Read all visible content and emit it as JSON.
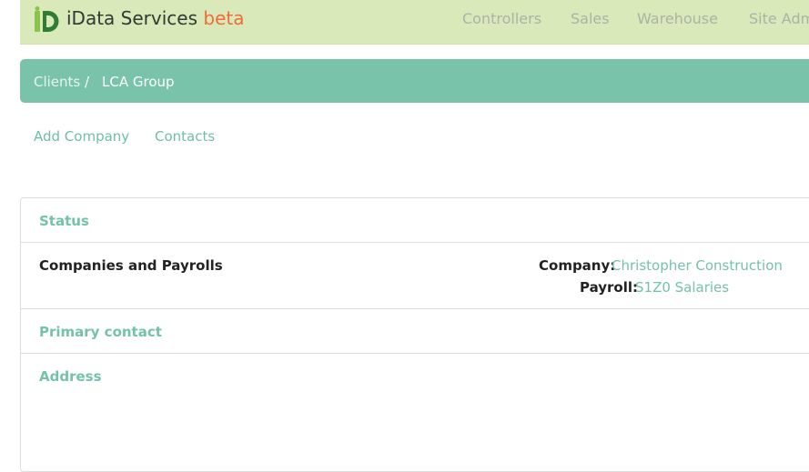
{
  "header": {
    "brand_name": "iData Services",
    "brand_tag": "beta",
    "logo_icon": "id-logo-icon",
    "nav": [
      "Controllers",
      "Sales",
      "Warehouse",
      "Site Admin"
    ]
  },
  "breadcrumb": {
    "parent": "Clients",
    "separator": "/",
    "current": "LCA Group"
  },
  "actions": {
    "add_company": "Add Company",
    "contacts": "Contacts"
  },
  "panel": {
    "status_label": "Status",
    "companies_label": "Companies and Payrolls",
    "company_label": "Company:",
    "company_value": "Christopher Construction",
    "payroll_label": "Payroll:",
    "payroll_value": "S1Z0 Salaries",
    "primary_contact_label": "Primary contact",
    "address_label": "Address"
  },
  "colors": {
    "header_bg": "#d9e9ba",
    "breadcrumb_bg": "#79c3aa",
    "accent": "#74c2a8",
    "beta": "#f06d3a"
  }
}
